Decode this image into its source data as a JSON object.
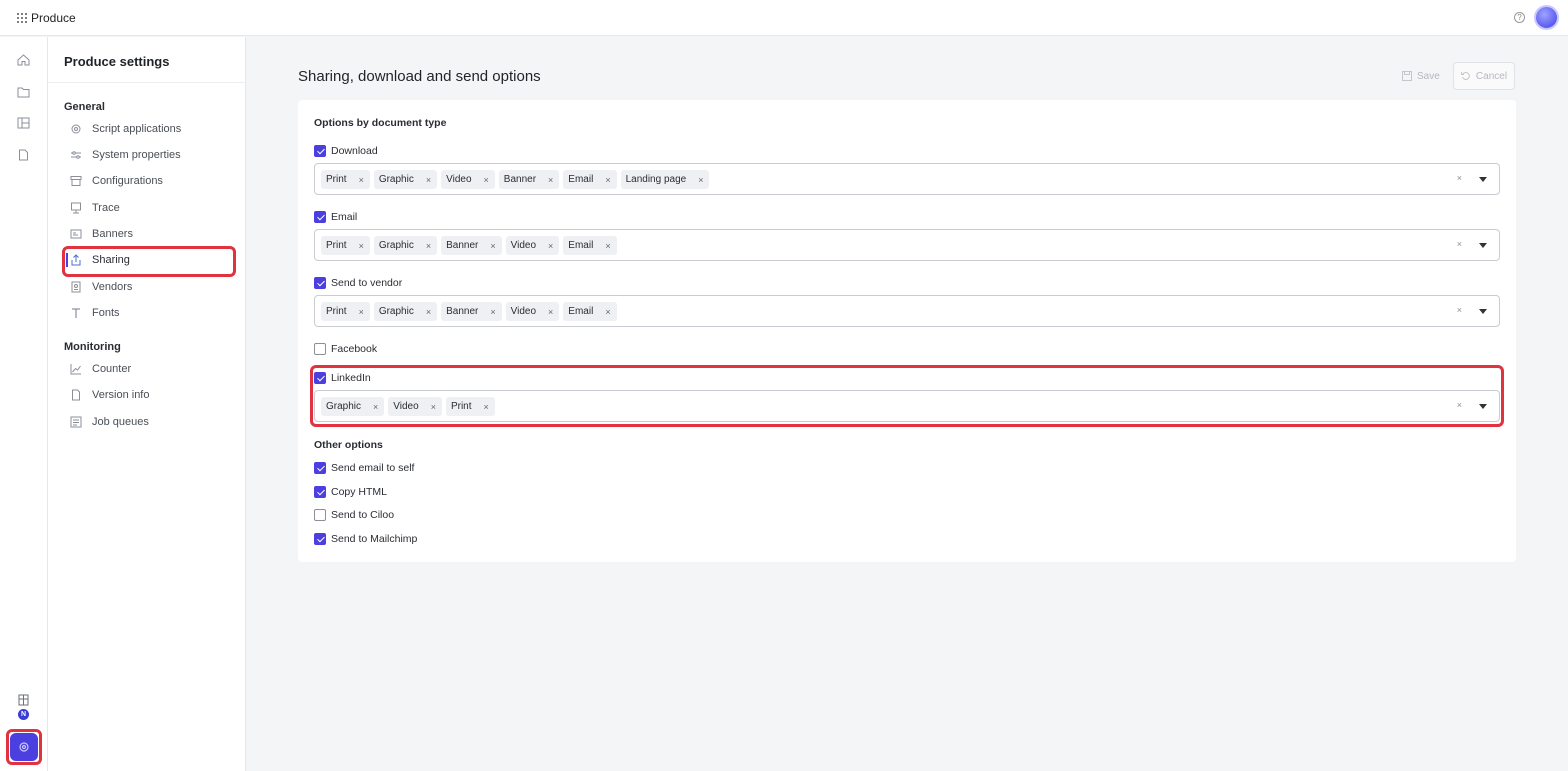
{
  "app": {
    "title": "Produce"
  },
  "settings_nav": {
    "title": "Produce settings",
    "general_heading": "General",
    "general_items": [
      {
        "label": "Script applications",
        "icon": "gear-icon"
      },
      {
        "label": "System properties",
        "icon": "sliders-icon"
      },
      {
        "label": "Configurations",
        "icon": "archive-icon"
      },
      {
        "label": "Trace",
        "icon": "monitor-icon"
      },
      {
        "label": "Banners",
        "icon": "banner-icon"
      },
      {
        "label": "Sharing",
        "icon": "share-icon",
        "active": true
      },
      {
        "label": "Vendors",
        "icon": "vendor-icon"
      },
      {
        "label": "Fonts",
        "icon": "font-icon"
      }
    ],
    "monitoring_heading": "Monitoring",
    "monitoring_items": [
      {
        "label": "Counter",
        "icon": "chart-line-icon"
      },
      {
        "label": "Version info",
        "icon": "file-icon"
      },
      {
        "label": "Job queues",
        "icon": "queue-icon"
      }
    ]
  },
  "rail": {
    "org_badge": "N"
  },
  "main": {
    "title": "Sharing, download and send options",
    "save_label": "Save",
    "cancel_label": "Cancel",
    "options_heading": "Options by document type",
    "doc_types": [
      {
        "label": "Download",
        "checked": true,
        "chips": [
          "Print",
          "Graphic",
          "Video",
          "Banner",
          "Email",
          "Landing page"
        ]
      },
      {
        "label": "Email",
        "checked": true,
        "chips": [
          "Print",
          "Graphic",
          "Banner",
          "Video",
          "Email"
        ]
      },
      {
        "label": "Send to vendor",
        "checked": true,
        "chips": [
          "Print",
          "Graphic",
          "Banner",
          "Video",
          "Email"
        ]
      },
      {
        "label": "Facebook",
        "checked": false,
        "chips": []
      },
      {
        "label": "LinkedIn",
        "checked": true,
        "chips": [
          "Graphic",
          "Video",
          "Print"
        ]
      }
    ],
    "other_heading": "Other options",
    "other_options": [
      {
        "label": "Send email to self",
        "checked": true
      },
      {
        "label": "Copy HTML",
        "checked": true
      },
      {
        "label": "Send to Ciloo",
        "checked": false
      },
      {
        "label": "Send to Mailchimp",
        "checked": true
      }
    ],
    "chip_remove": "×",
    "clear_all": "×"
  },
  "colors": {
    "accent": "#4b3fe0",
    "highlight": "#e0323f"
  }
}
